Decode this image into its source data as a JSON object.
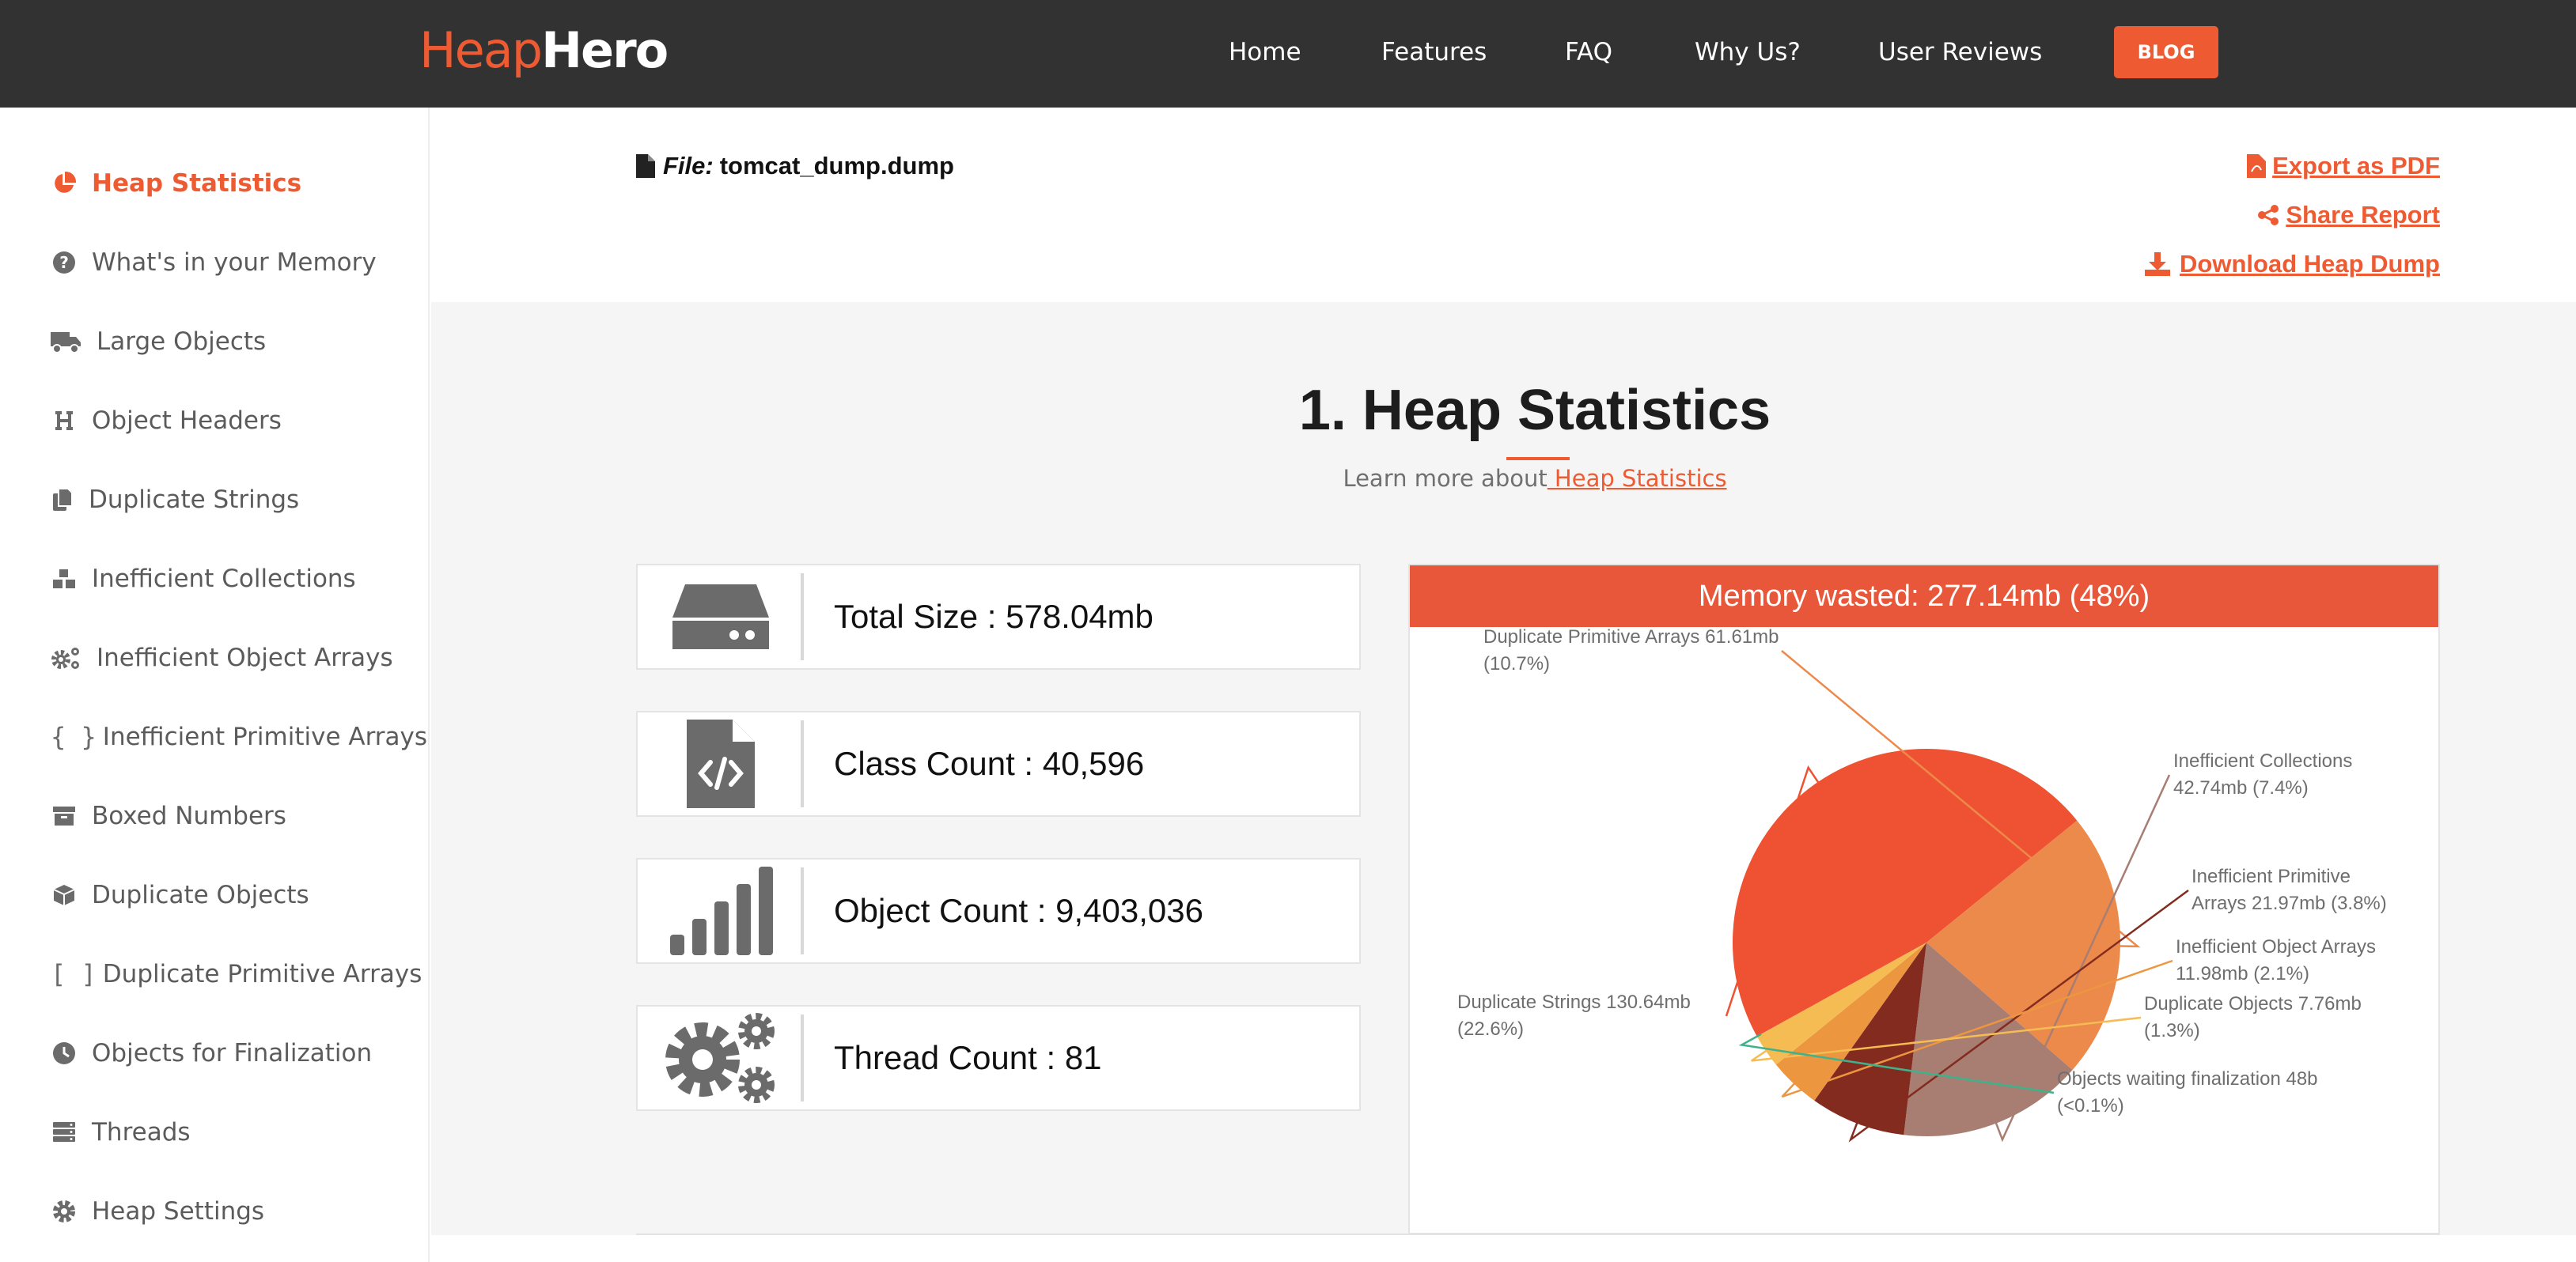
{
  "header": {
    "logo_part1": "Heap",
    "logo_part2": "Hero",
    "nav": [
      "Home",
      "Features",
      "FAQ",
      "Why Us?",
      "User Reviews"
    ],
    "blog_label": "BLOG"
  },
  "sidebar": {
    "items": [
      {
        "label": "Heap Statistics",
        "icon": "pie-chart-icon",
        "active": true
      },
      {
        "label": "What's in your Memory",
        "icon": "question-circle-icon"
      },
      {
        "label": "Large Objects",
        "icon": "truck-icon"
      },
      {
        "label": "Object Headers",
        "icon": "header-icon"
      },
      {
        "label": "Duplicate Strings",
        "icon": "copy-icon"
      },
      {
        "label": "Inefficient Collections",
        "icon": "cubes-icon"
      },
      {
        "label": "Inefficient Object Arrays",
        "icon": "cogs-icon"
      },
      {
        "label": "Inefficient Primitive Arrays",
        "icon_text": "{ }"
      },
      {
        "label": "Boxed Numbers",
        "icon": "archive-icon"
      },
      {
        "label": "Duplicate Objects",
        "icon": "cube-icon"
      },
      {
        "label": "Duplicate Primitive Arrays",
        "icon_text": "[ ]"
      },
      {
        "label": "Objects for Finalization",
        "icon": "clock-icon"
      },
      {
        "label": "Threads",
        "icon": "server-icon"
      },
      {
        "label": "Heap Settings",
        "icon": "gear-icon"
      }
    ]
  },
  "file": {
    "label": "File:",
    "name": "tomcat_dump.dump"
  },
  "actions": {
    "export_pdf": "Export as PDF",
    "share_report": "Share Report",
    "download_dump": "Download Heap Dump"
  },
  "section": {
    "title": "1. Heap Statistics",
    "learn_prefix": "Learn more about",
    "learn_link": " Heap Statistics"
  },
  "stats": [
    {
      "text": "Total Size : 578.04mb",
      "icon": "hdd-icon"
    },
    {
      "text": "Class Count : 40,596",
      "icon": "file-code-icon"
    },
    {
      "text": "Object Count : 9,403,036",
      "icon": "signal-bars-icon"
    },
    {
      "text": "Thread Count : 81",
      "icon": "cogs-icon"
    }
  ],
  "colors": {
    "accent": "#ee5b33",
    "header_bg": "#323232"
  },
  "chart_data": {
    "type": "pie",
    "title": "Memory wasted: 277.14mb (48%)",
    "slices": [
      {
        "label_line1": "Duplicate Strings 130.64mb",
        "label_line2": "(22.6%)",
        "value": 130.64,
        "color": "#ee5233"
      },
      {
        "label_line1": "Duplicate Primitive Arrays 61.61mb",
        "label_line2": "(10.7%)",
        "value": 61.61,
        "color": "#ec8a4b"
      },
      {
        "label_line1": "Inefficient Collections",
        "label_line2": "42.74mb (7.4%)",
        "value": 42.74,
        "color": "#a87d72"
      },
      {
        "label_line1": "Inefficient Primitive",
        "label_line2": "Arrays 21.97mb (3.8%)",
        "value": 21.97,
        "color": "#832b1f"
      },
      {
        "label_line1": "Inefficient Object Arrays",
        "label_line2": "11.98mb (2.1%)",
        "value": 11.98,
        "color": "#ed9640"
      },
      {
        "label_line1": "Duplicate Objects 7.76mb",
        "label_line2": "(1.3%)",
        "value": 7.76,
        "color": "#f6bc54"
      },
      {
        "label_line1": "Objects waiting finalization 48b",
        "label_line2": "(<0.1%)",
        "value": 4.6e-05,
        "color": "#3fb28c"
      }
    ]
  }
}
